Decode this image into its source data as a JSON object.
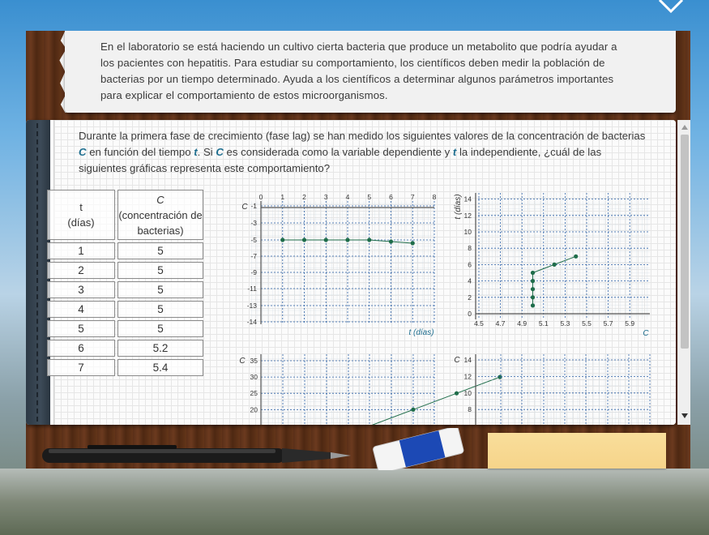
{
  "intro": {
    "text": "En el laboratorio se está haciendo un cultivo cierta bacteria que produce un metabolito que podría ayudar a los pacientes con hepatitis. Para estudiar su comportamiento, los científicos deben medir la población de bacterias por un tiempo determinado. Ayuda a los científicos a determinar algunos parámetros importantes para explicar el comportamiento de estos microorganismos."
  },
  "question": {
    "part1": "Durante la primera fase de crecimiento (fase lag) se han medido los siguientes valores de la concentración de bacterias ",
    "var_c": "C",
    "part2": " en función del tiempo ",
    "var_t": "t",
    "part3": ". Si ",
    "part4": " es considerada como la variable dependiente y ",
    "part5": " la independiente, ¿cuál de las siguientes gráficas representa este comportamiento?"
  },
  "table": {
    "header_t": "t",
    "header_t_unit": "(días)",
    "header_c": "C",
    "header_c_unit": "(concentración de bacterias)",
    "rows": [
      {
        "t": "1",
        "c": "5"
      },
      {
        "t": "2",
        "c": "5"
      },
      {
        "t": "3",
        "c": "5"
      },
      {
        "t": "4",
        "c": "5"
      },
      {
        "t": "5",
        "c": "5"
      },
      {
        "t": "6",
        "c": "5.2"
      },
      {
        "t": "7",
        "c": "5.4"
      }
    ]
  },
  "colors": {
    "series": "#1f6d4a",
    "dashed_grid": "#2f63a8",
    "axis": "#555555",
    "variable": "#1e6e8f"
  },
  "icons": [
    "collapse-chevron-icon",
    "scroll-up-icon",
    "scroll-down-icon"
  ],
  "chart_data": [
    {
      "type": "line",
      "option": "A",
      "ylabel": "C",
      "xlabel": "t (días)",
      "x_ticks": [
        "0",
        "1",
        "2",
        "3",
        "4",
        "5",
        "6",
        "7",
        "8"
      ],
      "y_ticks": [
        "-1",
        "-3",
        "-5",
        "-7",
        "-9",
        "-11",
        "-13",
        "-14"
      ],
      "xlim": [
        0,
        8
      ],
      "x": [
        1,
        2,
        3,
        4,
        5,
        6,
        7
      ],
      "y": [
        -5,
        -5,
        -5,
        -5,
        -5,
        -5.2,
        -5.4
      ],
      "legend": "none",
      "grid": true
    },
    {
      "type": "line",
      "option": "B",
      "ylabel": "t (días)",
      "xlabel": "C",
      "x_ticks": [
        "4.5",
        "4.7",
        "4.9",
        "5.1",
        "5.3",
        "5.5",
        "5.7",
        "5.9"
      ],
      "y_ticks": [
        "0",
        "2",
        "4",
        "6",
        "8",
        "10",
        "12",
        "14"
      ],
      "xlim": [
        4.5,
        6.1
      ],
      "ylim": [
        0,
        14
      ],
      "x": [
        5,
        5,
        5,
        5,
        5,
        5.2,
        5.4
      ],
      "y": [
        1,
        2,
        3,
        4,
        5,
        6,
        7
      ],
      "legend": "none",
      "grid": true
    },
    {
      "type": "line",
      "option": "C",
      "ylabel": "C",
      "y_ticks": [
        "35",
        "30",
        "25",
        "20"
      ],
      "x": [
        5,
        6,
        7
      ],
      "y": [
        20,
        25,
        30
      ],
      "legend": "none",
      "grid": true
    },
    {
      "type": "line",
      "option": "D",
      "ylabel": "C",
      "y_ticks": [
        "14",
        "12",
        "10",
        "8"
      ],
      "legend": "none",
      "grid": true
    }
  ]
}
